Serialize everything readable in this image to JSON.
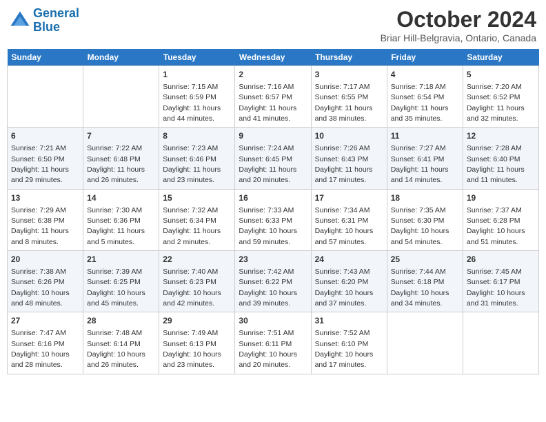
{
  "header": {
    "logo_line1": "General",
    "logo_line2": "Blue",
    "month": "October 2024",
    "location": "Briar Hill-Belgravia, Ontario, Canada"
  },
  "days_of_week": [
    "Sunday",
    "Monday",
    "Tuesday",
    "Wednesday",
    "Thursday",
    "Friday",
    "Saturday"
  ],
  "weeks": [
    [
      {
        "day": "",
        "info": ""
      },
      {
        "day": "",
        "info": ""
      },
      {
        "day": "1",
        "info": "Sunrise: 7:15 AM\nSunset: 6:59 PM\nDaylight: 11 hours and 44 minutes."
      },
      {
        "day": "2",
        "info": "Sunrise: 7:16 AM\nSunset: 6:57 PM\nDaylight: 11 hours and 41 minutes."
      },
      {
        "day": "3",
        "info": "Sunrise: 7:17 AM\nSunset: 6:55 PM\nDaylight: 11 hours and 38 minutes."
      },
      {
        "day": "4",
        "info": "Sunrise: 7:18 AM\nSunset: 6:54 PM\nDaylight: 11 hours and 35 minutes."
      },
      {
        "day": "5",
        "info": "Sunrise: 7:20 AM\nSunset: 6:52 PM\nDaylight: 11 hours and 32 minutes."
      }
    ],
    [
      {
        "day": "6",
        "info": "Sunrise: 7:21 AM\nSunset: 6:50 PM\nDaylight: 11 hours and 29 minutes."
      },
      {
        "day": "7",
        "info": "Sunrise: 7:22 AM\nSunset: 6:48 PM\nDaylight: 11 hours and 26 minutes."
      },
      {
        "day": "8",
        "info": "Sunrise: 7:23 AM\nSunset: 6:46 PM\nDaylight: 11 hours and 23 minutes."
      },
      {
        "day": "9",
        "info": "Sunrise: 7:24 AM\nSunset: 6:45 PM\nDaylight: 11 hours and 20 minutes."
      },
      {
        "day": "10",
        "info": "Sunrise: 7:26 AM\nSunset: 6:43 PM\nDaylight: 11 hours and 17 minutes."
      },
      {
        "day": "11",
        "info": "Sunrise: 7:27 AM\nSunset: 6:41 PM\nDaylight: 11 hours and 14 minutes."
      },
      {
        "day": "12",
        "info": "Sunrise: 7:28 AM\nSunset: 6:40 PM\nDaylight: 11 hours and 11 minutes."
      }
    ],
    [
      {
        "day": "13",
        "info": "Sunrise: 7:29 AM\nSunset: 6:38 PM\nDaylight: 11 hours and 8 minutes."
      },
      {
        "day": "14",
        "info": "Sunrise: 7:30 AM\nSunset: 6:36 PM\nDaylight: 11 hours and 5 minutes."
      },
      {
        "day": "15",
        "info": "Sunrise: 7:32 AM\nSunset: 6:34 PM\nDaylight: 11 hours and 2 minutes."
      },
      {
        "day": "16",
        "info": "Sunrise: 7:33 AM\nSunset: 6:33 PM\nDaylight: 10 hours and 59 minutes."
      },
      {
        "day": "17",
        "info": "Sunrise: 7:34 AM\nSunset: 6:31 PM\nDaylight: 10 hours and 57 minutes."
      },
      {
        "day": "18",
        "info": "Sunrise: 7:35 AM\nSunset: 6:30 PM\nDaylight: 10 hours and 54 minutes."
      },
      {
        "day": "19",
        "info": "Sunrise: 7:37 AM\nSunset: 6:28 PM\nDaylight: 10 hours and 51 minutes."
      }
    ],
    [
      {
        "day": "20",
        "info": "Sunrise: 7:38 AM\nSunset: 6:26 PM\nDaylight: 10 hours and 48 minutes."
      },
      {
        "day": "21",
        "info": "Sunrise: 7:39 AM\nSunset: 6:25 PM\nDaylight: 10 hours and 45 minutes."
      },
      {
        "day": "22",
        "info": "Sunrise: 7:40 AM\nSunset: 6:23 PM\nDaylight: 10 hours and 42 minutes."
      },
      {
        "day": "23",
        "info": "Sunrise: 7:42 AM\nSunset: 6:22 PM\nDaylight: 10 hours and 39 minutes."
      },
      {
        "day": "24",
        "info": "Sunrise: 7:43 AM\nSunset: 6:20 PM\nDaylight: 10 hours and 37 minutes."
      },
      {
        "day": "25",
        "info": "Sunrise: 7:44 AM\nSunset: 6:18 PM\nDaylight: 10 hours and 34 minutes."
      },
      {
        "day": "26",
        "info": "Sunrise: 7:45 AM\nSunset: 6:17 PM\nDaylight: 10 hours and 31 minutes."
      }
    ],
    [
      {
        "day": "27",
        "info": "Sunrise: 7:47 AM\nSunset: 6:16 PM\nDaylight: 10 hours and 28 minutes."
      },
      {
        "day": "28",
        "info": "Sunrise: 7:48 AM\nSunset: 6:14 PM\nDaylight: 10 hours and 26 minutes."
      },
      {
        "day": "29",
        "info": "Sunrise: 7:49 AM\nSunset: 6:13 PM\nDaylight: 10 hours and 23 minutes."
      },
      {
        "day": "30",
        "info": "Sunrise: 7:51 AM\nSunset: 6:11 PM\nDaylight: 10 hours and 20 minutes."
      },
      {
        "day": "31",
        "info": "Sunrise: 7:52 AM\nSunset: 6:10 PM\nDaylight: 10 hours and 17 minutes."
      },
      {
        "day": "",
        "info": ""
      },
      {
        "day": "",
        "info": ""
      }
    ]
  ]
}
